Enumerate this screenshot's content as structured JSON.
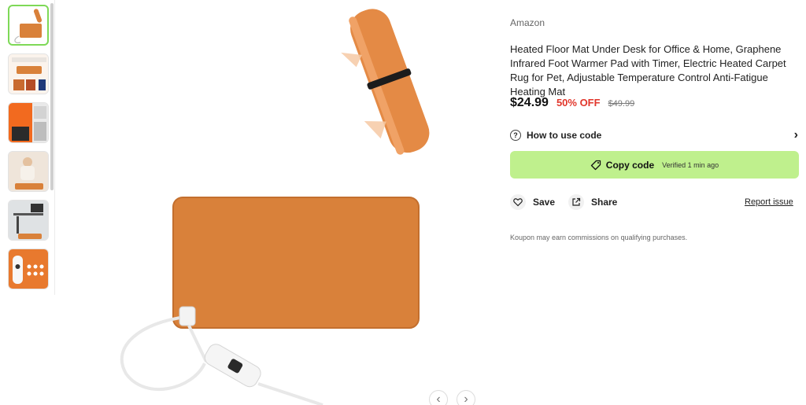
{
  "gallery": {
    "thumbnails": [
      {
        "alt": "mat-roll-thumb"
      },
      {
        "alt": "mat-infographic-thumb"
      },
      {
        "alt": "mat-features-thumb"
      },
      {
        "alt": "mat-lifestyle-thumb"
      },
      {
        "alt": "mat-desk-thumb"
      },
      {
        "alt": "mat-controller-thumb"
      }
    ],
    "prev_label": "‹",
    "next_label": "›"
  },
  "product": {
    "store": "Amazon",
    "title": "Heated Floor Mat Under Desk for Office & Home, Graphene Infrared Foot Warmer Pad with Timer, Electric Heated Carpet Rug for Pet, Adjustable Temperature Control Anti-Fatigue Heating Mat",
    "price": "$24.99",
    "discount": "50% OFF",
    "original_price": "$49.99"
  },
  "actions": {
    "how_to_label": "How to use code",
    "how_to_icon": "question-icon",
    "copy_label": "Copy code",
    "verified_text": "Verified 1 min ago",
    "save_label": "Save",
    "share_label": "Share",
    "report_label": "Report issue"
  },
  "disclaimer": "Koupon may earn commissions on qualifying purchases.",
  "colors": {
    "accent": "#bff08d",
    "discount": "#e1362b",
    "mat": "#d9813a",
    "active_thumb_border": "#7ed957"
  }
}
